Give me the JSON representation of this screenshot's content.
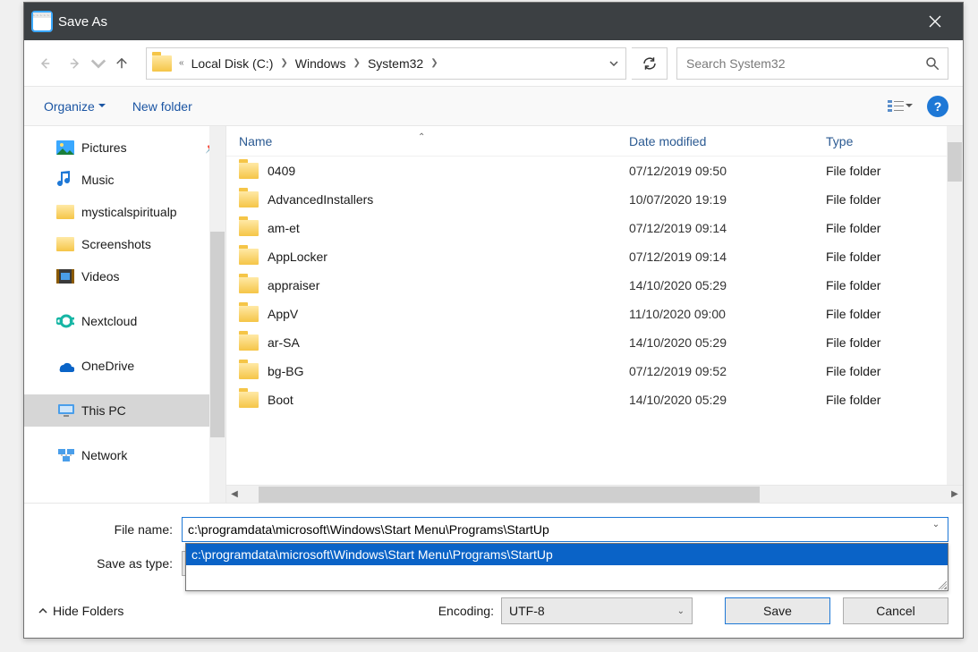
{
  "window": {
    "title": "Save As"
  },
  "nav": {
    "path_segments": [
      "Local Disk (C:)",
      "Windows",
      "System32"
    ],
    "search_placeholder": "Search System32"
  },
  "toolbar": {
    "organize": "Organize",
    "newfolder": "New folder"
  },
  "sidebar": {
    "items": [
      {
        "label": "Pictures",
        "icon": "pictures",
        "pinned": true
      },
      {
        "label": "Music",
        "icon": "music"
      },
      {
        "label": "mysticalspiritualp",
        "icon": "folder"
      },
      {
        "label": "Screenshots",
        "icon": "folder"
      },
      {
        "label": "Videos",
        "icon": "videos"
      },
      {
        "label": "Nextcloud",
        "icon": "nextcloud",
        "spaced": true
      },
      {
        "label": "OneDrive",
        "icon": "onedrive",
        "spaced": true
      },
      {
        "label": "This PC",
        "icon": "thispc",
        "selected": true,
        "spaced": true
      },
      {
        "label": "Network",
        "icon": "network",
        "spaced": true
      }
    ]
  },
  "list": {
    "columns": {
      "name": "Name",
      "date": "Date modified",
      "type": "Type"
    },
    "rows": [
      {
        "name": "0409",
        "date": "07/12/2019 09:50",
        "type": "File folder"
      },
      {
        "name": "AdvancedInstallers",
        "date": "10/07/2020 19:19",
        "type": "File folder"
      },
      {
        "name": "am-et",
        "date": "07/12/2019 09:14",
        "type": "File folder"
      },
      {
        "name": "AppLocker",
        "date": "07/12/2019 09:14",
        "type": "File folder"
      },
      {
        "name": "appraiser",
        "date": "14/10/2020 05:29",
        "type": "File folder"
      },
      {
        "name": "AppV",
        "date": "11/10/2020 09:00",
        "type": "File folder"
      },
      {
        "name": "ar-SA",
        "date": "14/10/2020 05:29",
        "type": "File folder"
      },
      {
        "name": "bg-BG",
        "date": "07/12/2019 09:52",
        "type": "File folder"
      },
      {
        "name": "Boot",
        "date": "14/10/2020 05:29",
        "type": "File folder"
      }
    ]
  },
  "form": {
    "filename_label": "File name:",
    "filename_value": "c:\\programdata\\microsoft\\Windows\\Start Menu\\Programs\\StartUp",
    "savetype_label": "Save as type:",
    "autocomplete_item": "c:\\programdata\\microsoft\\Windows\\Start Menu\\Programs\\StartUp",
    "encoding_label": "Encoding:",
    "encoding_value": "UTF-8",
    "hide_folders": "Hide Folders",
    "save": "Save",
    "cancel": "Cancel"
  }
}
